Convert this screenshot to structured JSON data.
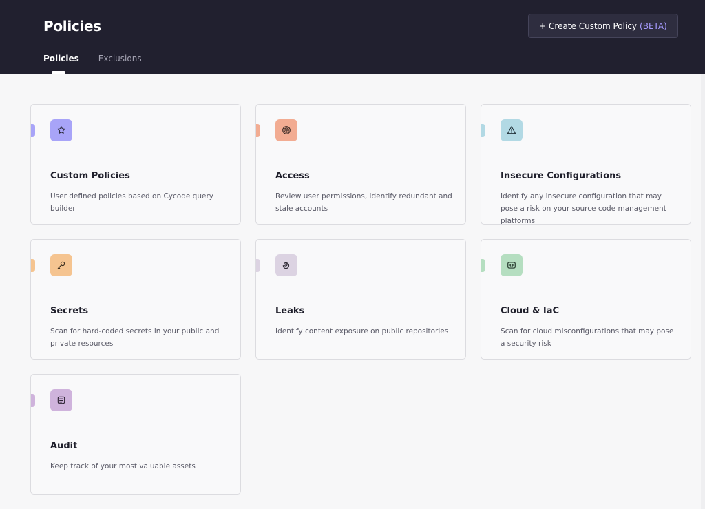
{
  "header": {
    "title": "Policies",
    "create_button": {
      "label": "+ Create Custom Policy",
      "badge": "(BETA)"
    },
    "tabs": [
      {
        "label": "Policies",
        "active": true
      },
      {
        "label": "Exclusions",
        "active": false
      }
    ]
  },
  "cards": [
    {
      "title": "Custom Policies",
      "description": "User defined policies based on Cycode query builder",
      "icon": "star-icon",
      "color": "#a8a4f8"
    },
    {
      "title": "Access",
      "description": "Review user permissions, identify redundant and stale accounts",
      "icon": "fingerprint-icon",
      "color": "#f2ac92"
    },
    {
      "title": "Insecure Configurations",
      "description": "Identify any insecure configuration that may pose a risk on your source code management platforms",
      "icon": "warning-icon",
      "color": "#b2d9e4"
    },
    {
      "title": "Secrets",
      "description": "Scan for hard-coded secrets in your public and private resources",
      "icon": "key-icon",
      "color": "#f5c490"
    },
    {
      "title": "Leaks",
      "description": "Identify content exposure on public repositories",
      "icon": "spiral-icon",
      "color": "#dcd3e2"
    },
    {
      "title": "Cloud & IaC",
      "description": "Scan for cloud misconfigurations that may pose a security risk",
      "icon": "code-icon",
      "color": "#b5dec0"
    },
    {
      "title": "Audit",
      "description": "Keep track of your most valuable assets",
      "icon": "document-icon",
      "color": "#cfb3dc"
    }
  ]
}
